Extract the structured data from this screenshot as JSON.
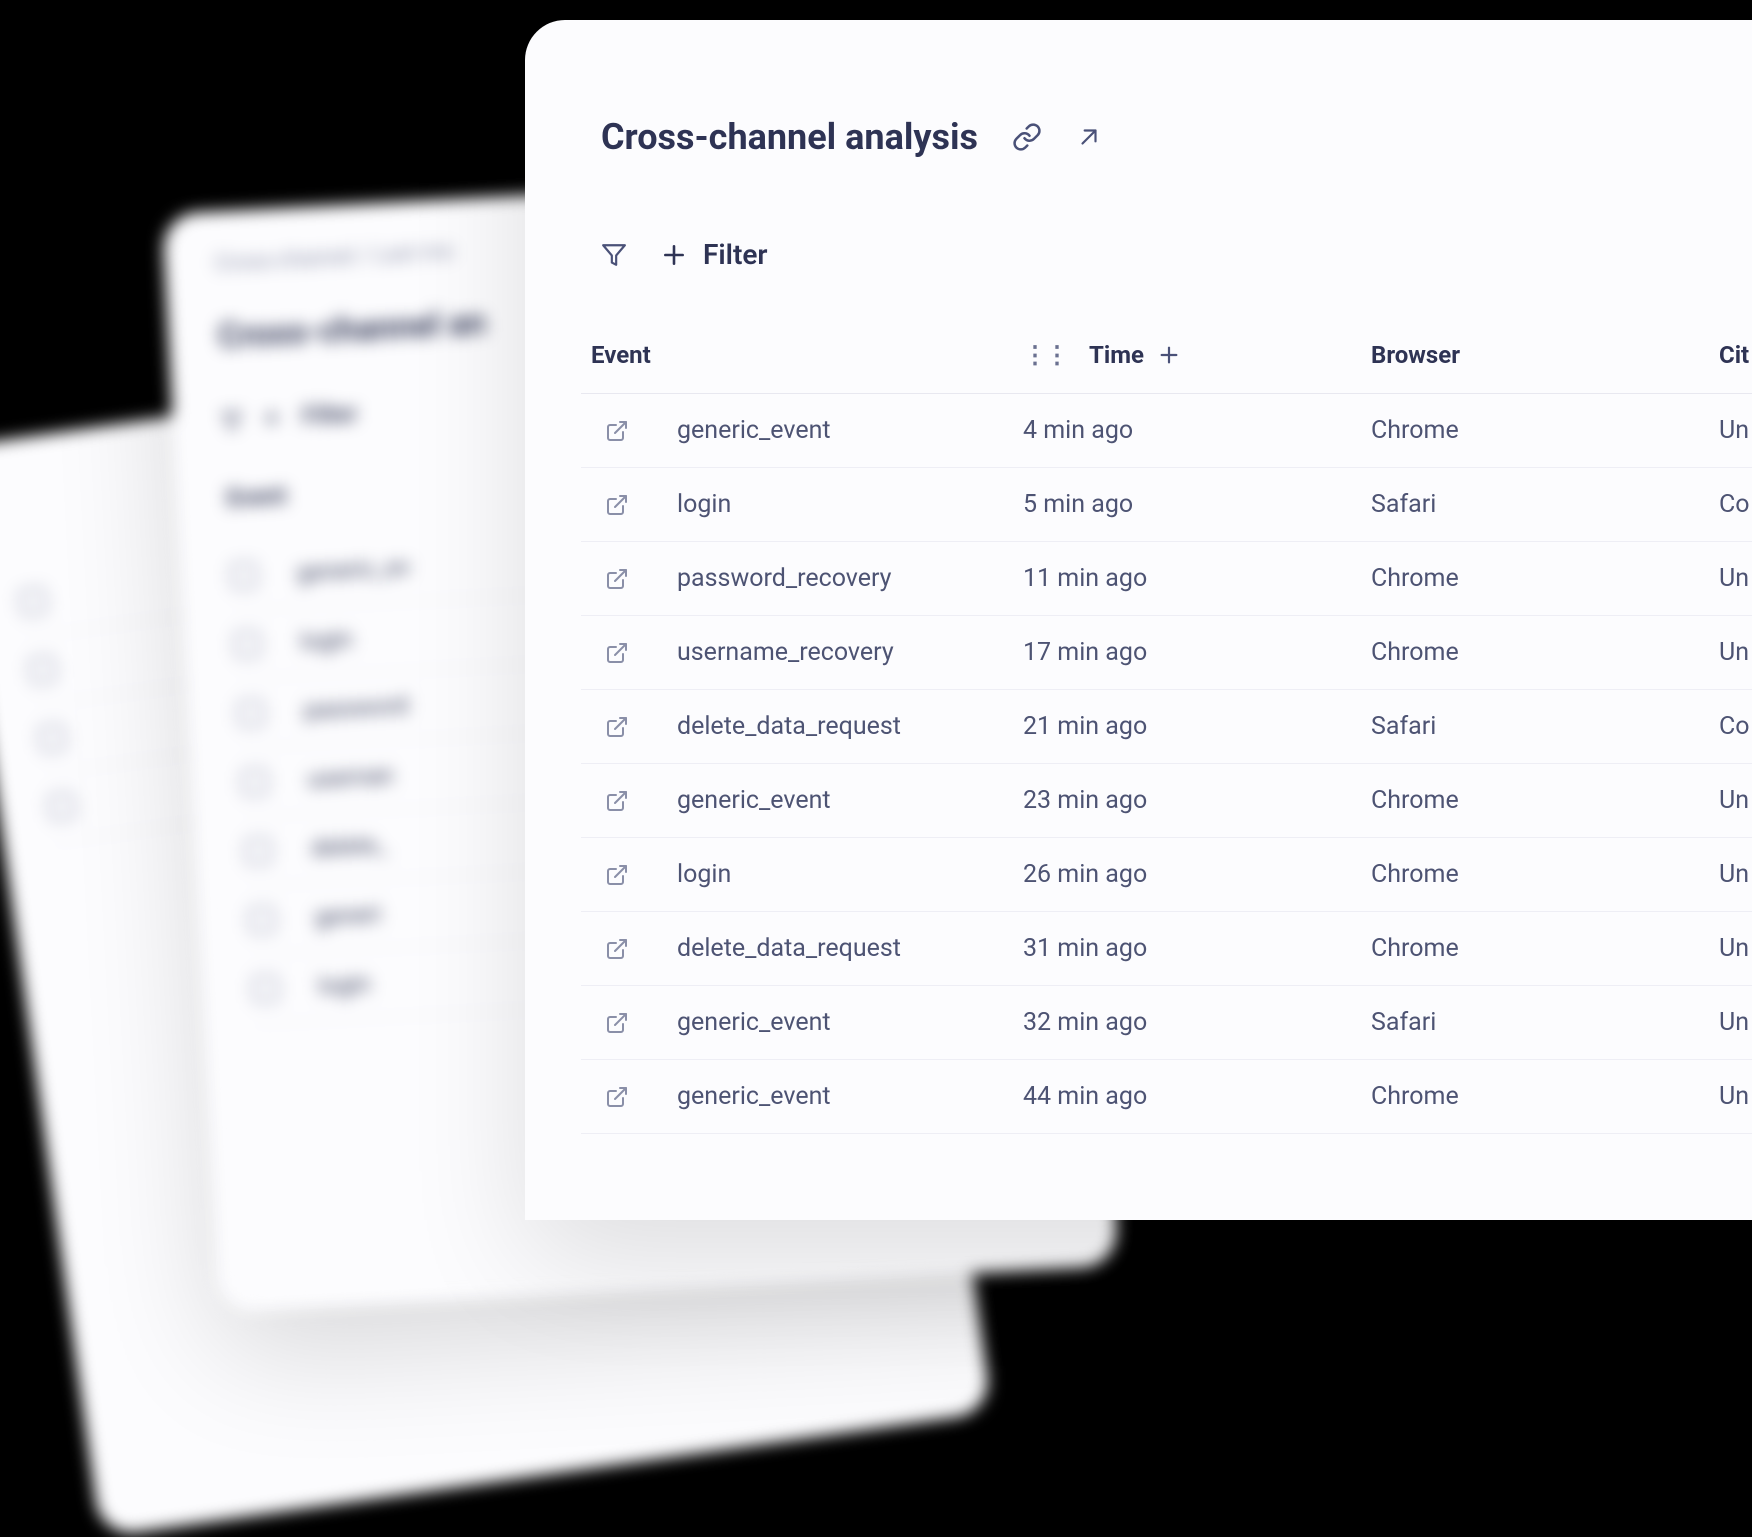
{
  "header": {
    "title": "Cross-channel analysis"
  },
  "toolbar": {
    "filter_label": "Filter"
  },
  "columns": {
    "event": "Event",
    "time": "Time",
    "browser": "Browser",
    "city": "Cit"
  },
  "rows": [
    {
      "event": "generic_event",
      "time": "4 min ago",
      "browser": "Chrome",
      "city": "Un"
    },
    {
      "event": "login",
      "time": "5 min ago",
      "browser": "Safari",
      "city": "Co"
    },
    {
      "event": "password_recovery",
      "time": "11 min ago",
      "browser": "Chrome",
      "city": "Un"
    },
    {
      "event": "username_recovery",
      "time": "17 min ago",
      "browser": "Chrome",
      "city": "Un"
    },
    {
      "event": "delete_data_request",
      "time": "21 min ago",
      "browser": "Safari",
      "city": "Co"
    },
    {
      "event": "generic_event",
      "time": "23 min ago",
      "browser": "Chrome",
      "city": "Un"
    },
    {
      "event": "login",
      "time": "26 min ago",
      "browser": "Chrome",
      "city": "Un"
    },
    {
      "event": "delete_data_request",
      "time": "31 min ago",
      "browser": "Chrome",
      "city": "Un"
    },
    {
      "event": "generic_event",
      "time": "32 min ago",
      "browser": "Safari",
      "city": "Un"
    },
    {
      "event": "generic_event",
      "time": "44 min ago",
      "browser": "Chrome",
      "city": "Un"
    }
  ],
  "background": {
    "breadcrumb": "Cross-channel / Last mo",
    "title": "Cross-channel an",
    "filter": "Filter",
    "head": "Event",
    "rows": [
      "generic_ev",
      "login",
      "password",
      "usernan",
      "delete_",
      "generi",
      "login"
    ]
  }
}
